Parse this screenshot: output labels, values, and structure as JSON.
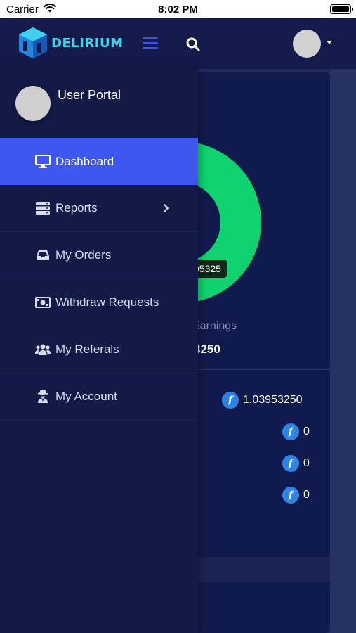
{
  "status_bar": {
    "carrier": "Carrier",
    "time": "8:02 PM"
  },
  "header": {
    "app_name": "DELIRIUM"
  },
  "drawer": {
    "title": "User Portal",
    "items": [
      {
        "label": "Dashboard",
        "icon": "monitor-icon",
        "active": true
      },
      {
        "label": "Reports",
        "icon": "server-icon",
        "has_submenu": true
      },
      {
        "label": "My Orders",
        "icon": "inbox-icon"
      },
      {
        "label": "Withdraw Requests",
        "icon": "money-bill-icon"
      },
      {
        "label": "My Referals",
        "icon": "users-icon"
      },
      {
        "label": "My Account",
        "icon": "user-secret-icon"
      }
    ]
  },
  "background": {
    "tooltip_value": "95325",
    "earnings_label": "Earnings",
    "earnings_value": "3250",
    "balances": [
      "1.03953250",
      "0",
      "0",
      "0"
    ]
  },
  "colors": {
    "accent": "#3e57f0",
    "donut": "#0fd36e",
    "coin": "#2e83e6",
    "drawer_bg": "#131a48"
  }
}
